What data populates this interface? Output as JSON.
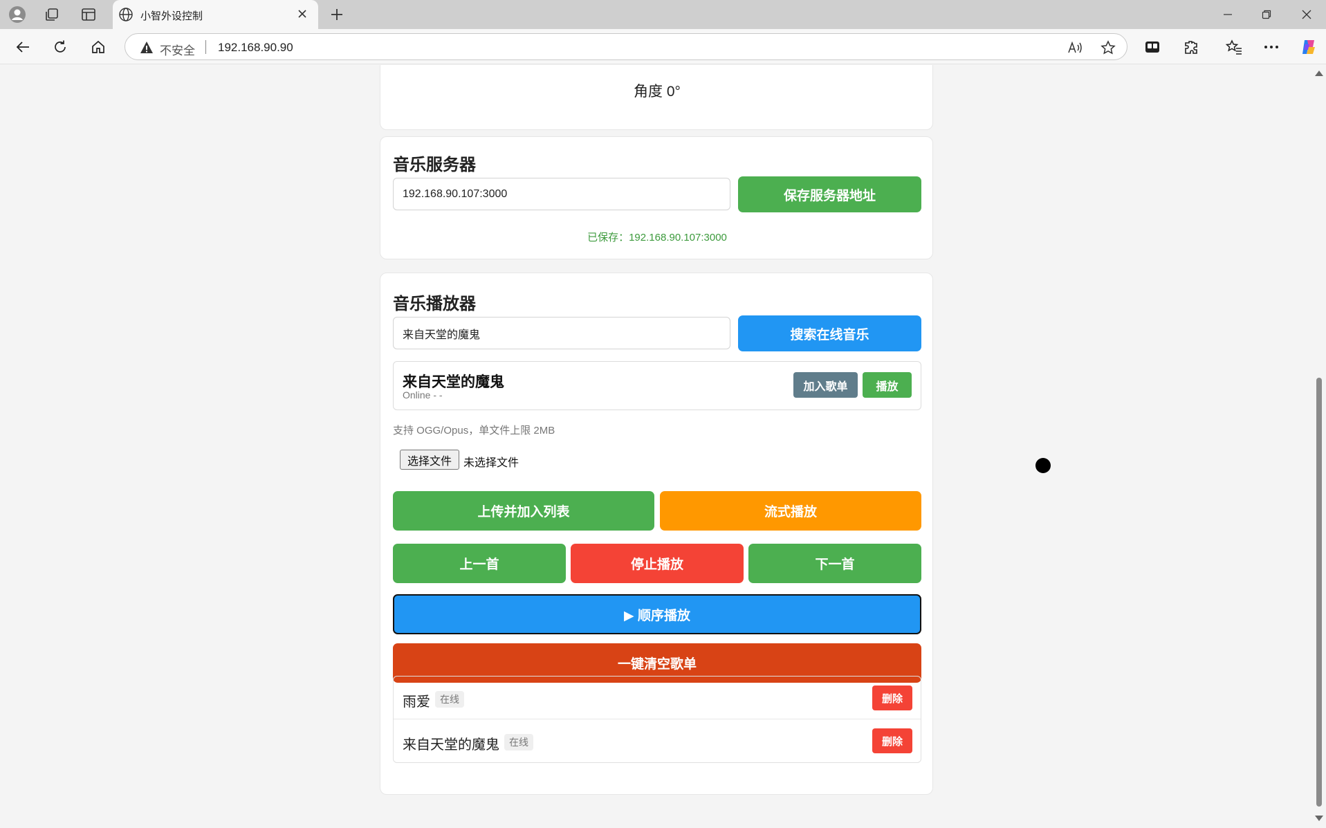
{
  "browser": {
    "tab_title": "小智外设控制",
    "insecure_label": "不安全",
    "url": "192.168.90.90"
  },
  "angle": {
    "text": "角度 0°"
  },
  "server": {
    "title": "音乐服务器",
    "address_value": "192.168.90.107:3000",
    "save_label": "保存服务器地址",
    "saved_note": "已保存：192.168.90.107:3000"
  },
  "player": {
    "title": "音乐播放器",
    "search_value": "来自天堂的魔鬼",
    "search_label": "搜索在线音乐",
    "result": {
      "title": "来自天堂的魔鬼",
      "subtitle": "Online - -",
      "add_label": "加入歌单",
      "play_label": "播放"
    },
    "hint": "支持 OGG/Opus，单文件上限 2MB",
    "file_button": "选择文件",
    "file_none": "未选择文件",
    "upload_label": "上传并加入列表",
    "stream_label": "流式播放",
    "prev_label": "上一首",
    "stop_label": "停止播放",
    "next_label": "下一首",
    "order_label": "▶ 顺序播放",
    "clear_label": "一键清空歌单",
    "playlist": [
      {
        "name": "雨爱",
        "tag": "在线",
        "delete_label": "删除"
      },
      {
        "name": "来自天堂的魔鬼",
        "tag": "在线",
        "delete_label": "删除"
      }
    ]
  },
  "colors": {
    "green": "#4caf50",
    "blue": "#2196f3",
    "orange": "#ff9800",
    "red": "#f44336",
    "dark_orange": "#d84315",
    "slate": "#607d8b"
  }
}
